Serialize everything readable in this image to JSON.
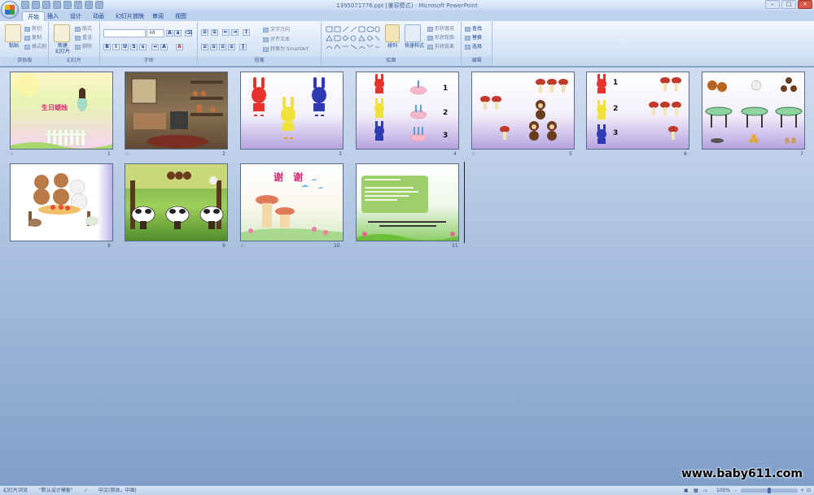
{
  "window": {
    "title": "1395071776.ppt [兼容模式] - Microsoft PowerPoint"
  },
  "tabs": [
    {
      "label": "开始",
      "active": true
    },
    {
      "label": "插入"
    },
    {
      "label": "设计"
    },
    {
      "label": "动画"
    },
    {
      "label": "幻灯片放映"
    },
    {
      "label": "审阅"
    },
    {
      "label": "视图"
    }
  ],
  "ribbon": {
    "clipboard": {
      "paste": "粘贴",
      "cut": "剪切",
      "copy": "复制",
      "format_painter": "格式刷",
      "label": "剪贴板"
    },
    "slides": {
      "new_slide": "新建\n幻灯片",
      "layout": "版式",
      "reset": "重设",
      "delete": "删除",
      "label": "幻灯片"
    },
    "font": {
      "font_name": "",
      "font_size": "48",
      "label": "字体"
    },
    "paragraph": {
      "text_direction": "文字方向",
      "align_text": "对齐文本",
      "smartart": "转换为 SmartArt",
      "label": "段落"
    },
    "drawing": {
      "arrange": "排列",
      "quick_styles": "快速样式",
      "shape_fill": "形状填充",
      "shape_outline": "形状轮廓",
      "shape_effects": "形状效果",
      "label": "绘图"
    },
    "editing": {
      "find": "查找",
      "replace": "替换",
      "select": "选择",
      "label": "编辑"
    }
  },
  "slides": [
    {
      "number": "1",
      "title": "生日蜡烛"
    },
    {
      "number": "2"
    },
    {
      "number": "3"
    },
    {
      "number": "4",
      "labels": [
        "1",
        "2",
        "3"
      ]
    },
    {
      "number": "5"
    },
    {
      "number": "6",
      "labels": [
        "1",
        "2",
        "3"
      ]
    },
    {
      "number": "7"
    },
    {
      "number": "8"
    },
    {
      "number": "9"
    },
    {
      "number": "10",
      "title": "谢 谢"
    },
    {
      "number": "11"
    }
  ],
  "watermark": "www.baby611.com",
  "status": {
    "view": "幻灯片浏览",
    "theme": "\"默认设计模板\"",
    "language": "中文(简体，中国)",
    "zoom": "100%",
    "zoom_level": 0.5
  },
  "colors": {
    "ribbon": "#d5e3f5",
    "workspace": "#7f9fc9",
    "accent": "#15428b"
  }
}
